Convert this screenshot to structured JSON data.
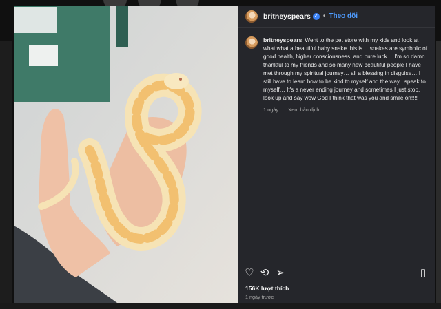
{
  "post": {
    "username": "britneyspears",
    "follow_label": "Theo dõi",
    "caption": "Went to the pet store with my kids and look at what what a beautiful baby snake this is… snakes are symbolic of good health, higher consciousness, and pure luck… I'm so damn thankful to my friends and so many new beautiful people I have met through my spiritual journey… all a blessing in disguise… I still have to learn how to be kind to myself and the way I speak to myself… It's a never ending journey and sometimes I just stop, look up and say wow God I think that was you and smile on!!!!",
    "comment_age": "1 ngày",
    "see_translation": "Xem bản dịch",
    "likes": "156K lượt thích",
    "posted": "1 ngày trước"
  },
  "icons": {
    "verified": "verified-badge-icon",
    "like": "heart-icon",
    "repost": "repost-icon",
    "share": "send-icon",
    "save": "bookmark-icon"
  },
  "colors": {
    "panel_bg": "#25262b",
    "follow": "#4f9cff",
    "verified": "#3b82f6"
  }
}
